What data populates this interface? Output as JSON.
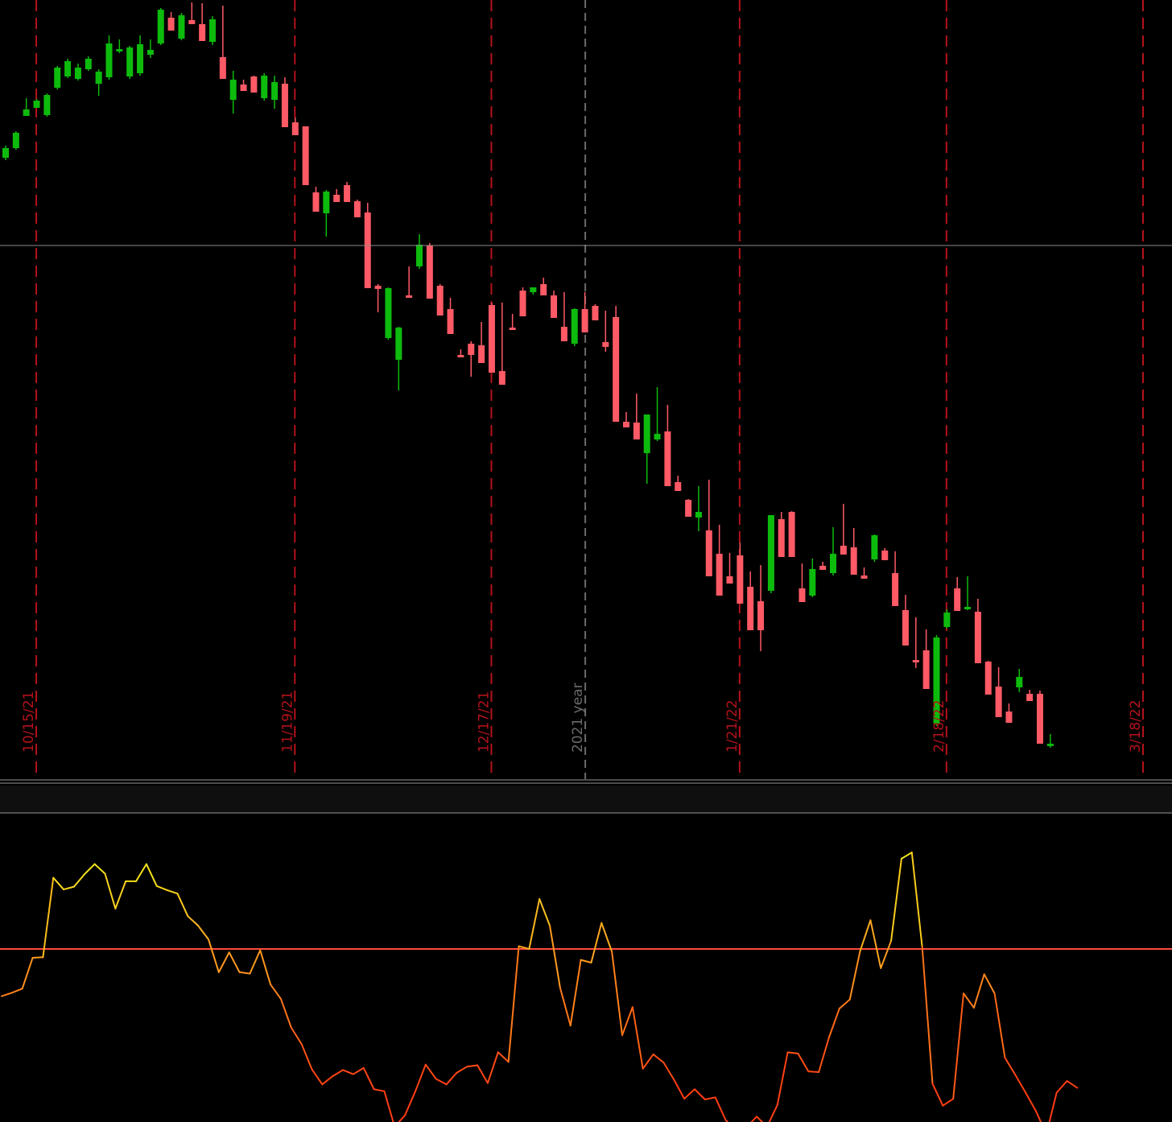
{
  "chart_data": [
    {
      "type": "candlestick",
      "panel": "price",
      "x_axis": "date",
      "grid": false,
      "colors": {
        "up": "#0dbb0d",
        "down": "#ff5a66",
        "marker_line": "#b3121b",
        "year_line": "#6b6b6b",
        "crosshair": "#8c8c8c"
      },
      "date_markers": [
        {
          "label": "10/15/21",
          "index": 3
        },
        {
          "label": "11/19/21",
          "index": 28
        },
        {
          "label": "12/17/21",
          "index": 47
        },
        {
          "label": "1/21/22",
          "index": 71
        },
        {
          "label": "2/18/22",
          "index": 91
        },
        {
          "label": "3/18/22",
          "index": 110
        }
      ],
      "year_marker": {
        "label": "2021 year",
        "index": 56
      },
      "ohlc": [
        [
          196,
          199,
          181,
          184
        ],
        [
          184,
          186,
          163,
          165
        ],
        [
          144,
          141,
          122,
          136
        ],
        [
          134,
          131,
          123,
          125
        ],
        [
          143,
          145,
          116,
          118
        ],
        [
          109,
          111,
          82,
          84
        ],
        [
          95,
          97,
          73,
          76
        ],
        [
          98,
          100,
          79,
          84
        ],
        [
          86,
          88,
          70,
          73
        ],
        [
          104,
          119,
          86,
          89
        ],
        [
          96,
          99,
          44,
          54
        ],
        [
          62,
          66,
          49,
          61
        ],
        [
          95,
          98,
          57,
          59
        ],
        [
          91,
          94,
          44,
          55
        ],
        [
          68,
          72,
          49,
          62
        ],
        [
          54,
          56,
          10,
          12
        ],
        [
          22,
          26,
          15,
          38
        ],
        [
          48,
          50,
          16,
          19
        ],
        [
          25,
          27,
          3,
          30
        ],
        [
          30,
          32,
          4,
          51
        ],
        [
          52,
          56,
          20,
          24
        ],
        [
          71,
          73,
          7,
          98
        ],
        [
          124,
          141,
          88,
          99
        ],
        [
          105,
          109,
          99,
          113
        ],
        [
          95,
          98,
          94,
          115
        ],
        [
          122,
          125,
          91,
          94
        ],
        [
          124,
          135,
          94,
          102
        ],
        [
          104,
          112,
          96,
          158
        ],
        [
          152,
          164,
          146,
          168
        ],
        [
          157,
          160,
          165,
          230
        ],
        [
          239,
          242,
          232,
          263
        ],
        [
          265,
          294,
          236,
          238
        ],
        [
          242,
          249,
          235,
          251
        ],
        [
          230,
          233,
          226,
          251
        ],
        [
          250,
          253,
          248,
          270
        ],
        [
          264,
          289,
          252,
          358
        ],
        [
          355,
          388,
          353,
          359
        ],
        [
          420,
          422,
          357,
          358
        ],
        [
          447,
          485,
          406,
          407
        ],
        [
          367,
          370,
          331,
          369
        ],
        [
          331,
          334,
          291,
          304
        ],
        [
          305,
          308,
          302,
          371
        ],
        [
          355,
          358,
          353,
          392
        ],
        [
          384,
          388,
          370,
          415
        ],
        [
          441,
          444,
          434,
          442
        ],
        [
          427,
          468,
          424,
          441
        ],
        [
          429,
          440,
          400,
          451
        ],
        [
          379,
          382,
          376,
          463
        ],
        [
          461,
          468,
          376,
          478
        ],
        [
          407,
          410,
          390,
          409
        ],
        [
          361,
          364,
          357,
          393
        ],
        [
          363,
          366,
          357,
          357
        ],
        [
          353,
          356,
          345,
          367
        ],
        [
          367,
          370,
          361,
          395
        ],
        [
          406,
          409,
          363,
          424
        ],
        [
          427,
          430,
          383,
          384
        ],
        [
          384,
          387,
          363,
          413
        ],
        [
          380,
          383,
          378,
          398
        ],
        [
          425,
          437,
          386,
          431
        ],
        [
          394,
          396,
          380,
          524
        ],
        [
          524,
          527,
          512,
          531
        ],
        [
          525,
          527,
          489,
          546
        ],
        [
          563,
          601,
          515,
          515
        ],
        [
          546,
          548,
          481,
          539
        ],
        [
          536,
          540,
          503,
          604
        ],
        [
          599,
          603,
          591,
          610
        ],
        [
          621,
          624,
          620,
          642
        ],
        [
          643,
          660,
          604,
          636
        ],
        [
          659,
          662,
          596,
          716
        ],
        [
          688,
          690,
          652,
          740
        ],
        [
          716,
          718,
          687,
          725
        ],
        [
          690,
          716,
          674,
          750
        ],
        [
          729,
          733,
          710,
          783
        ],
        [
          747,
          809,
          702,
          783
        ],
        [
          734,
          737,
          664,
          640
        ],
        [
          645,
          663,
          636,
          692
        ],
        [
          636,
          639,
          635,
          692
        ],
        [
          731,
          735,
          700,
          748
        ],
        [
          740,
          742,
          694,
          707
        ],
        [
          703,
          707,
          698,
          708
        ],
        [
          712,
          715,
          655,
          688
        ],
        [
          678,
          684,
          626,
          689
        ],
        [
          680,
          682,
          656,
          714
        ],
        [
          715,
          718,
          705,
          719
        ],
        [
          695,
          698,
          664,
          665
        ],
        [
          684,
          693,
          681,
          696
        ],
        [
          712,
          714,
          685,
          753
        ],
        [
          758,
          761,
          739,
          802
        ],
        [
          820,
          830,
          767,
          823
        ],
        [
          808,
          810,
          782,
          856
        ],
        [
          899,
          902,
          789,
          792
        ],
        [
          779,
          781,
          757,
          761
        ],
        [
          731,
          734,
          717,
          759
        ],
        [
          756,
          758,
          716,
          754
        ],
        [
          760,
          763,
          744,
          824
        ],
        [
          822,
          827,
          821,
          863
        ],
        [
          853,
          861,
          829,
          891
        ],
        [
          884,
          898,
          874,
          898
        ],
        [
          854,
          860,
          831,
          841
        ],
        [
          862,
          866,
          857,
          871
        ],
        [
          862,
          867,
          858,
          924
        ],
        [
          925,
          929,
          912,
          924
        ]
      ]
    },
    {
      "type": "line",
      "panel": "oscillator",
      "colors": {
        "high": "#f5e81b",
        "mid": "#ffa21f",
        "low": "#ff3d12",
        "reference_line": "#ff4a3d"
      },
      "reference_level": 0,
      "values": [
        -0.69,
        -0.64,
        -0.58,
        -0.13,
        -0.12,
        1.04,
        0.87,
        0.91,
        1.09,
        1.24,
        1.1,
        0.59,
        0.99,
        0.99,
        1.24,
        0.92,
        0.86,
        0.81,
        0.48,
        0.34,
        0.14,
        -0.34,
        -0.05,
        -0.34,
        -0.36,
        -0.02,
        -0.52,
        -0.73,
        -1.15,
        -1.39,
        -1.76,
        -1.98,
        -1.86,
        -1.77,
        -1.83,
        -1.74,
        -2.05,
        -2.08,
        -2.6,
        -2.43,
        -2.08,
        -1.69,
        -1.9,
        -1.98,
        -1.81,
        -1.72,
        -1.7,
        -1.96,
        -1.51,
        -1.65,
        0.04,
        0.0,
        0.73,
        0.34,
        -0.57,
        -1.12,
        -0.16,
        -0.2,
        0.38,
        -0.04,
        -1.26,
        -0.85,
        -1.75,
        -1.54,
        -1.66,
        -1.91,
        -2.19,
        -2.05,
        -2.2,
        -2.17,
        -2.5,
        -2.66,
        -2.61,
        -2.45,
        -2.6,
        -2.28,
        -1.51,
        -1.53,
        -1.79,
        -1.8,
        -1.29,
        -0.87,
        -0.74,
        -0.03,
        0.42,
        -0.28,
        0.12,
        1.32,
        1.41,
        0.03,
        -1.97,
        -2.29,
        -2.19,
        -0.65,
        -0.86,
        -0.37,
        -0.65,
        -1.59,
        -1.84,
        -2.1,
        -2.37,
        -2.71,
        -2.1,
        -1.93,
        -2.03
      ]
    }
  ]
}
